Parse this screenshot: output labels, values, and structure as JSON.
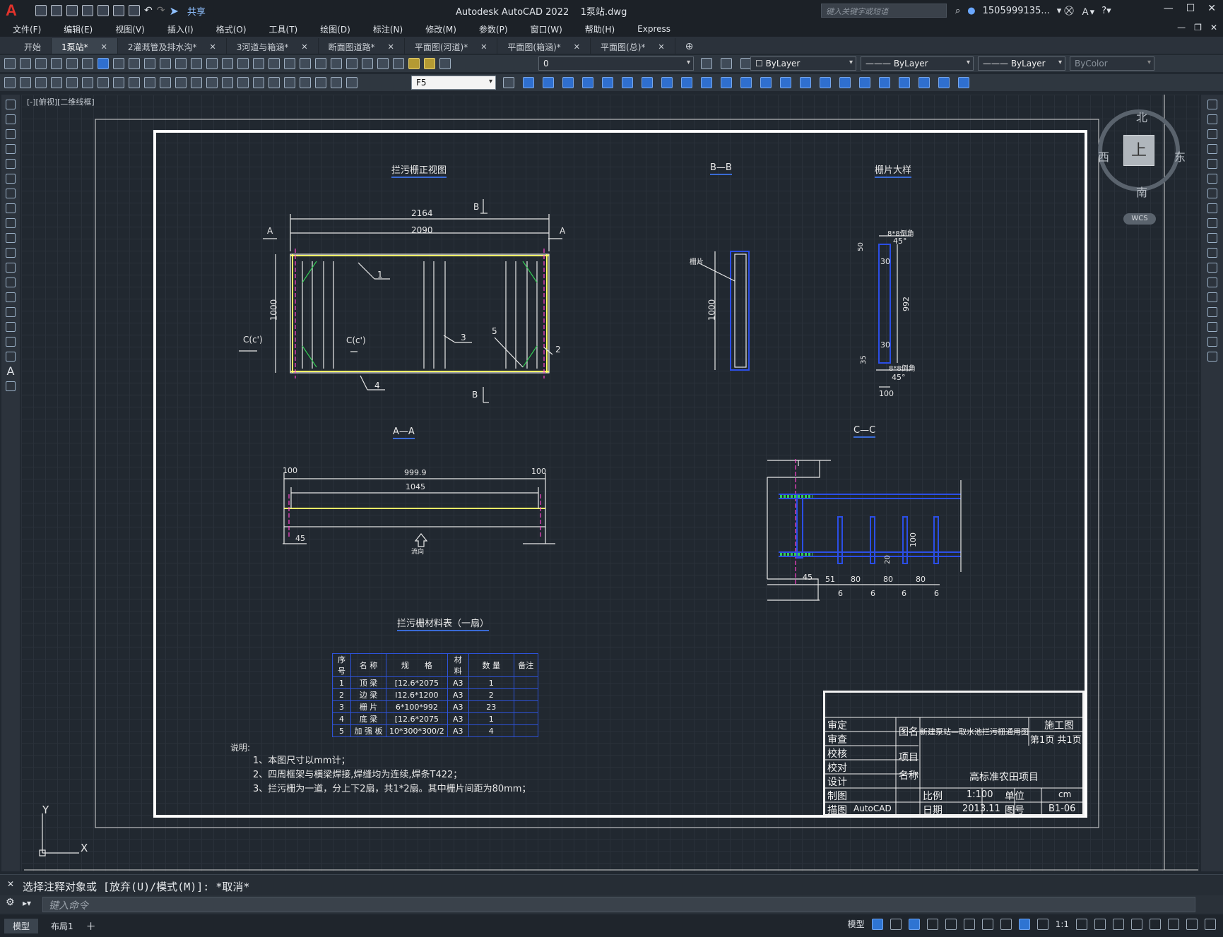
{
  "app": {
    "title": "Autodesk AutoCAD 2022",
    "file": "1泵站.dwg",
    "share": "共享",
    "search_placeholder": "键入关键字或短语",
    "user": "1505999135...",
    "logo": "A"
  },
  "menu": [
    "文件(F)",
    "编辑(E)",
    "视图(V)",
    "插入(I)",
    "格式(O)",
    "工具(T)",
    "绘图(D)",
    "标注(N)",
    "修改(M)",
    "参数(P)",
    "窗口(W)",
    "帮助(H)",
    "Express"
  ],
  "tabs": [
    {
      "label": "开始",
      "active": false,
      "closable": false
    },
    {
      "label": "1泵站*",
      "active": true,
      "closable": true
    },
    {
      "label": "2灌溉管及排水沟*",
      "active": false,
      "closable": true
    },
    {
      "label": "3河道与箱涵*",
      "active": false,
      "closable": true
    },
    {
      "label": "断面图道路*",
      "active": false,
      "closable": true
    },
    {
      "label": "平面图(河道)*",
      "active": false,
      "closable": true
    },
    {
      "label": "平面图(箱涵)*",
      "active": false,
      "closable": true
    },
    {
      "label": "平面图(总)*",
      "active": false,
      "closable": true
    }
  ],
  "toolbar": {
    "layer": "0",
    "color": "ByLayer",
    "linetype": "ByLayer",
    "lineweight": "ByLayer",
    "plotstyle": "ByColor",
    "textstyle": "F5"
  },
  "viewport_label": "[-][俯视][二维线框]",
  "viewcube": {
    "north": "北",
    "south": "南",
    "west": "西",
    "east": "东",
    "face": "上",
    "wcs": "WCS"
  },
  "drawing": {
    "titles": {
      "front": "拦污栅正视图",
      "bb": "B—B",
      "detail": "栅片大样",
      "aa": "A—A",
      "cc": "C—C",
      "materials": "拦污栅材料表（一扇）"
    },
    "front_dims": {
      "d2164": "2164",
      "d2090": "2090",
      "d1000": "1000"
    },
    "front_labels": {
      "A": "A",
      "B": "B",
      "C": "C(c')",
      "n1": "1",
      "n2": "2",
      "n3": "3",
      "n4": "4",
      "n5": "5"
    },
    "bb_labels": {
      "grate": "栅片",
      "d1000": "1000"
    },
    "detail_labels": {
      "top": "8*8倒角",
      "ang": "45°",
      "d50": "50",
      "d30a": "30",
      "d992": "992",
      "d30b": "30",
      "d35": "35",
      "bottom": "8*8倒角",
      "ang2": "45°",
      "d100": "100"
    },
    "aa_labels": {
      "d100a": "100",
      "d999": "999.9",
      "d100b": "100",
      "d1045": "1045",
      "d45": "45",
      "flow": "流向"
    },
    "cc_labels": {
      "d45": "45",
      "d51": "51",
      "d80a": "80",
      "d80b": "80",
      "d80c": "80",
      "d6a": "6",
      "d6b": "6",
      "d6c": "6",
      "d6d": "6",
      "d100": "100",
      "d20": "20"
    },
    "materials": {
      "headers": [
        "序号",
        "名 称",
        "规　　格",
        "材料",
        "数 量",
        "备注"
      ],
      "rows": [
        [
          "1",
          "顶 梁",
          "[12.6*2075",
          "A3",
          "1",
          ""
        ],
        [
          "2",
          "边 梁",
          "I12.6*1200",
          "A3",
          "2",
          ""
        ],
        [
          "3",
          "栅 片",
          "6*100*992",
          "A3",
          "23",
          ""
        ],
        [
          "4",
          "底 梁",
          "[12.6*2075",
          "A3",
          "1",
          ""
        ],
        [
          "5",
          "加 强 板",
          "10*300*300/2",
          "A3",
          "4",
          ""
        ]
      ]
    },
    "notes": {
      "label": "说明:",
      "n1": "1、本图尺寸以mm计；",
      "n2": "2、四周框架与横梁焊接,焊缝均为连续,焊条T422；",
      "n3": "3、拦污栅为一道，分上下2扇，共1*2扇。其中栅片间距为80mm；"
    },
    "titleblock": {
      "shending": "审定",
      "shencha": "审查",
      "jiaohe": "校核",
      "jiaodui": "校对",
      "sheji": "设计",
      "zhitu": "制图",
      "miaotu": "描图",
      "miaotu_val": "AutoCAD",
      "tuming": "图名",
      "tuming_val": "新建泵站—取水池拦污栅通用图",
      "shigongtu": "施工图",
      "page": "第1页 共1页",
      "xiangmu": "项目",
      "mingcheng": "名称",
      "project": "高标准农田项目",
      "bili": "比例",
      "bili_val": "1:100",
      "danwei": "单位",
      "danwei_val": "cm",
      "riqi": "日期",
      "riqi_val": "2013.11",
      "tuhao": "图号",
      "tuhao_val": "B1-06"
    }
  },
  "command": {
    "history": "选择注释对象或 [放弃(U)/模式(M)]: *取消*",
    "placeholder": "键入命令"
  },
  "layout_tabs": {
    "model": "模型",
    "layout1": "布局1"
  },
  "status": {
    "model": "模型",
    "scale": "1:1"
  },
  "ucs": {
    "x": "X",
    "y": "Y"
  }
}
